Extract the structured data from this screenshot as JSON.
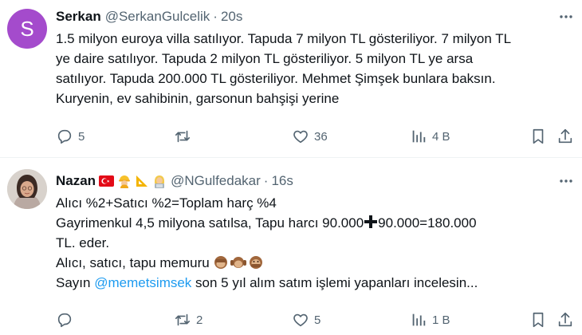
{
  "tweets": [
    {
      "avatar_letter": "S",
      "name": "Serkan",
      "handle": "@SerkanGulcelik",
      "time": "20s",
      "lines": [
        "1.5 milyon euroya villa satılıyor.  Tapuda 7 milyon TL gösteriliyor. 7 milyon TL",
        "ye daire satılıyor. Tapuda 2 milyon TL gösteriliyor. 5 milyon TL ye arsa",
        "satılıyor. Tapuda 200.000 TL gösteriliyor. Mehmet Şimşek bunlara baksın.",
        "Kuryenin, ev sahibinin, garsonun bahşişi yerine"
      ],
      "actions": {
        "replies": "5",
        "reposts": "",
        "likes": "36",
        "views": "4 B"
      }
    },
    {
      "name": "Nazan",
      "handle": "@NGulfedakar",
      "time": "16s",
      "name_emoji": [
        "turkish-flag",
        "construction-worker",
        "triangular-ruler",
        "woman-technologist"
      ],
      "line1": "Alıcı %2+Satıcı %2=Toplam harç %4",
      "line2_a": "Gayrimenkul 4,5 milyona satılsa, Tapu harcı 90.000",
      "line2_b": "90.000=180.000",
      "line3": "TL. eder.",
      "line4": "Alıcı, satıcı, tapu memuru",
      "line4_emoji": [
        "see-no-evil-monkey",
        "hear-no-evil-monkey",
        "speak-no-evil-monkey"
      ],
      "line5_a": "Sayın ",
      "line5_mention": "@memetsimsek",
      "line5_b": " son 5 yıl alım satım işlemi yapanları incelesin...",
      "actions": {
        "replies": "",
        "reposts": "2",
        "likes": "5",
        "views": "1 B"
      }
    }
  ],
  "colors": {
    "text": "#0f1419",
    "secondary": "#536471",
    "link": "#1d9bf0",
    "avatar_bg": "#a44bcc",
    "divider": "#eff3f4"
  }
}
